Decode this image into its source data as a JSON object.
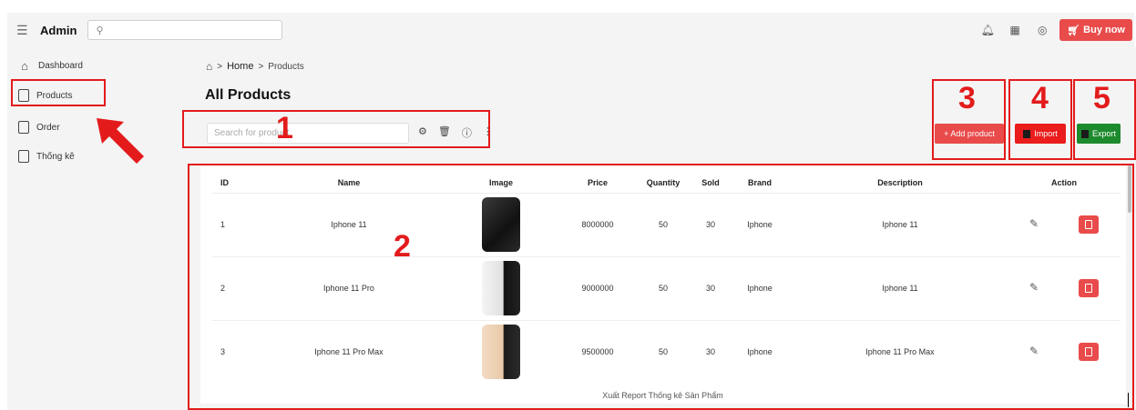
{
  "header": {
    "brand": "Admin",
    "search_placeholder": "",
    "buy_label": "Buy now",
    "icons": [
      "bell-icon",
      "apps-grid-icon",
      "user-circle-icon",
      "cart-icon"
    ]
  },
  "sidebar": {
    "items": [
      {
        "label": "Dashboard",
        "icon": "home-icon"
      },
      {
        "label": "Products",
        "icon": "page-icon"
      },
      {
        "label": "Order",
        "icon": "page-icon"
      },
      {
        "label": "Thống kê",
        "icon": "page-icon"
      }
    ]
  },
  "breadcrumb": {
    "sep": ">",
    "home": "Home",
    "current": "Products"
  },
  "page": {
    "title": "All Products",
    "search_placeholder": "Search for product"
  },
  "actions": {
    "add_label": "+ Add product",
    "import_label": "Import",
    "export_label": "Export"
  },
  "annotations": {
    "n1": "1",
    "n2": "2",
    "n3": "3",
    "n4": "4",
    "n5": "5"
  },
  "table": {
    "headers": [
      "ID",
      "Name",
      "Image",
      "Price",
      "Quantity",
      "Sold",
      "Brand",
      "Description",
      "Action"
    ],
    "rows": [
      {
        "id": "1",
        "name": "Iphone 11",
        "price": "8000000",
        "quantity": "50",
        "sold": "30",
        "brand": "Iphone",
        "description": "Iphone 11"
      },
      {
        "id": "2",
        "name": "Iphone 11 Pro",
        "price": "9000000",
        "quantity": "50",
        "sold": "30",
        "brand": "Iphone",
        "description": "Iphone 11"
      },
      {
        "id": "3",
        "name": "Iphone 11 Pro Max",
        "price": "9500000",
        "quantity": "50",
        "sold": "30",
        "brand": "Iphone",
        "description": "Iphone 11 Pro Max"
      }
    ]
  },
  "footer": {
    "report_text": "Xuất Report Thống kê Sản Phẩm"
  },
  "colors": {
    "accent_red": "#e94b4b",
    "annotation_red": "#e31b1b",
    "export_green": "#1e8a2e"
  }
}
